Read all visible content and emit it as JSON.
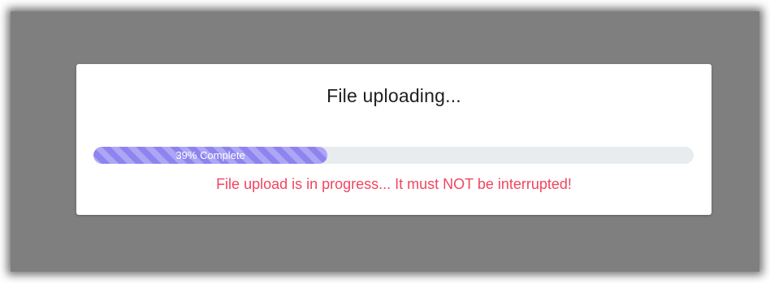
{
  "modal": {
    "title": "File uploading...",
    "progress": {
      "percent": 39,
      "label": "39% Complete"
    },
    "warning": "File upload is in progress... It must NOT be interrupted!"
  },
  "colors": {
    "backdrop": "#7f7f7f",
    "progress_fill": "#8d84f0",
    "progress_track": "#e9ecef",
    "warning_text": "#f2455f"
  }
}
